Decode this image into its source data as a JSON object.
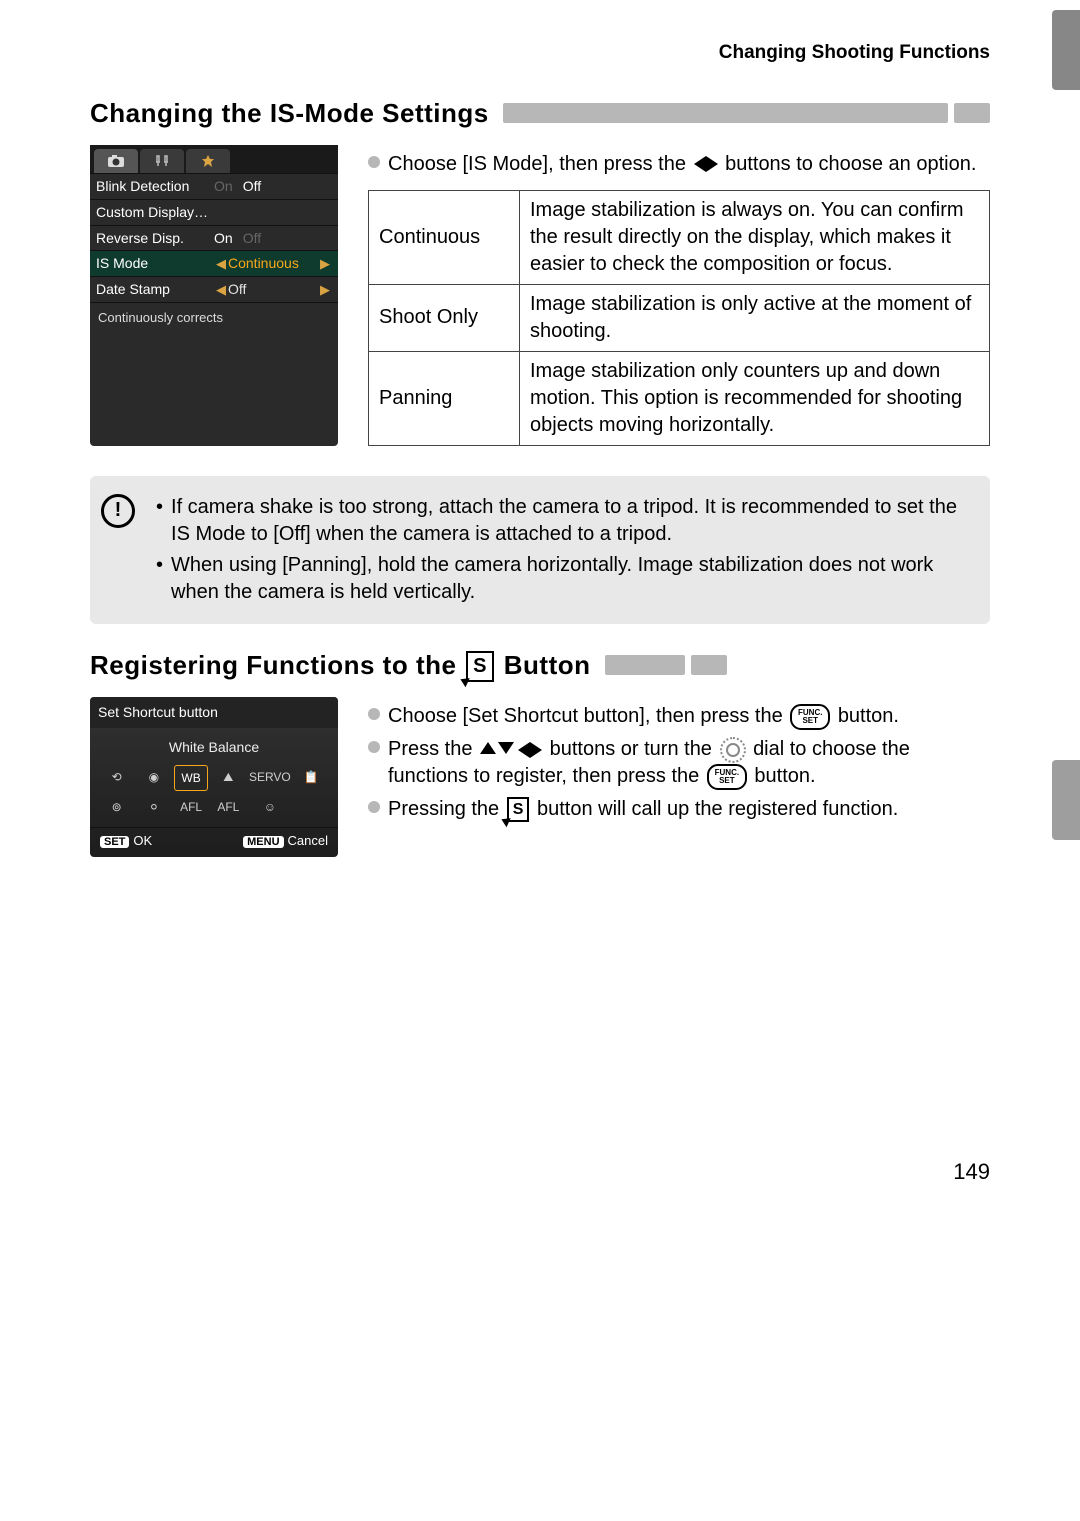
{
  "header": {
    "right_title": "Changing Shooting Functions"
  },
  "section1": {
    "title": "Changing the IS-Mode Settings",
    "instruction_pre": "Choose [IS Mode], then press the ",
    "instruction_post": " buttons to choose an option.",
    "menu": {
      "rows": [
        {
          "label": "Blink Detection",
          "on": "On",
          "off": "Off",
          "selected": "Off"
        },
        {
          "label": "Custom Display…"
        },
        {
          "label": "Reverse Disp.",
          "on": "On",
          "off": "Off",
          "selected": "On"
        },
        {
          "label": "IS Mode",
          "value": "Continuous",
          "highlight": true
        },
        {
          "label": "Date Stamp",
          "value": "Off"
        }
      ],
      "footer": "Continuously corrects"
    },
    "table": [
      {
        "mode": "Continuous",
        "desc": "Image stabilization is always on. You can confirm the result directly on the display, which makes it easier to check the composition or focus."
      },
      {
        "mode": "Shoot Only",
        "desc": "Image stabilization is only active at the moment of shooting."
      },
      {
        "mode": "Panning",
        "desc": "Image stabilization only counters up and down motion. This option is recommended for shooting objects moving horizontally."
      }
    ],
    "notes": [
      "If camera shake is too strong, attach the camera to a tripod. It is recommended to set the IS Mode to [Off] when the camera is attached to a tripod.",
      "When using [Panning], hold the camera horizontally. Image stabilization does not work when the camera is held vertically."
    ]
  },
  "section2": {
    "title_pre": "Registering Functions to the ",
    "title_post": " Button",
    "shortcut_shot": {
      "title": "Set Shortcut button",
      "mode_label": "White Balance",
      "grid": [
        "⟲",
        "◉",
        "WB",
        "⛰",
        "SERVO",
        "📋",
        "⊚",
        "⚪︎",
        "AFL",
        "AFL",
        "☺",
        ""
      ],
      "selected_index": 2,
      "ok_btn": "SET",
      "ok_label": "OK",
      "cancel_btn": "MENU",
      "cancel_label": "Cancel"
    },
    "steps": {
      "s1_pre": "Choose [Set Shortcut button], then press the ",
      "s1_post": " button.",
      "s2_pre": "Press the ",
      "s2_mid": " buttons or turn the ",
      "s2_mid2": " dial to choose the functions to register, then press the ",
      "s2_post": " button.",
      "s3_pre": "Pressing the ",
      "s3_post": " button will call up the registered function."
    }
  },
  "page_number": "149",
  "icons": {
    "func_set": "FUNC. SET"
  }
}
